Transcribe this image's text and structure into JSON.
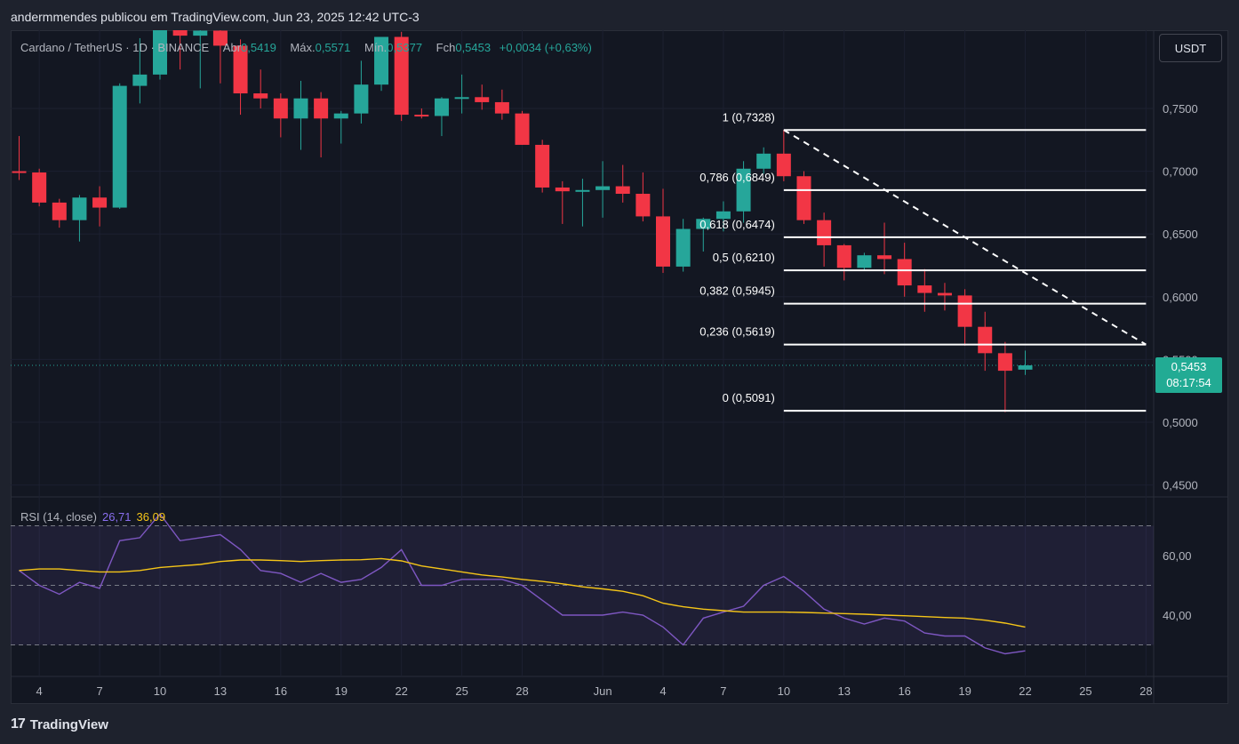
{
  "header": {
    "published_by": "andermmendes publicou em TradingView.com, Jun 23, 2025 12:42 UTC-3"
  },
  "legend": {
    "symbol": "Cardano / TetherUS · 1D · BINANCE",
    "open_label": "Abr",
    "open": "0,5419",
    "high_label": "Máx.",
    "high": "0,5571",
    "low_label": "Mín.",
    "low": "0,5377",
    "close_label": "Fch",
    "close": "0,5453",
    "change": "+0,0034 (+0,63%)"
  },
  "currency_button": "USDT",
  "price_tag": {
    "price": "0,5453",
    "countdown": "08:17:54"
  },
  "rsi_legend": {
    "name": "RSI (14, close)",
    "rsi": "26,71",
    "ma": "36,09"
  },
  "footer": {
    "brand": "TradingView",
    "logo_glyph": "17"
  },
  "colors": {
    "up": "#26a69a",
    "down": "#f23645",
    "rsi": "#7e57c2",
    "rsi_ma": "#f5c518",
    "background": "#131722"
  },
  "chart_data": [
    {
      "type": "candlestick",
      "title": "",
      "price_range": [
        0.445,
        0.79
      ],
      "y_ticks": [
        "0,7500",
        "0,7000",
        "0,6500",
        "0,6000",
        "0,5500",
        "0,5000",
        "0,4500"
      ],
      "y_tick_values": [
        0.75,
        0.7,
        0.65,
        0.6,
        0.55,
        0.5,
        0.45
      ],
      "x_ticks": [
        "4",
        "7",
        "10",
        "13",
        "16",
        "19",
        "22",
        "25",
        "28",
        "Jun",
        "4",
        "7",
        "10",
        "13",
        "16",
        "19",
        "22",
        "25",
        "28"
      ],
      "x_tick_days": [
        4,
        7,
        10,
        13,
        16,
        19,
        22,
        25,
        28,
        32,
        35,
        38,
        41,
        44,
        47,
        50,
        53,
        56,
        59
      ],
      "candles": [
        {
          "d": 3,
          "o": 0.7,
          "h": 0.728,
          "l": 0.693,
          "c": 0.699
        },
        {
          "d": 4,
          "o": 0.699,
          "h": 0.702,
          "l": 0.672,
          "c": 0.675
        },
        {
          "d": 5,
          "o": 0.675,
          "h": 0.678,
          "l": 0.655,
          "c": 0.661
        },
        {
          "d": 6,
          "o": 0.661,
          "h": 0.681,
          "l": 0.644,
          "c": 0.679
        },
        {
          "d": 7,
          "o": 0.679,
          "h": 0.688,
          "l": 0.656,
          "c": 0.671
        },
        {
          "d": 8,
          "o": 0.671,
          "h": 0.77,
          "l": 0.67,
          "c": 0.768
        },
        {
          "d": 9,
          "o": 0.768,
          "h": 0.806,
          "l": 0.754,
          "c": 0.777
        },
        {
          "d": 10,
          "o": 0.777,
          "h": 0.835,
          "l": 0.773,
          "c": 0.82
        },
        {
          "d": 11,
          "o": 0.82,
          "h": 0.838,
          "l": 0.781,
          "c": 0.808
        },
        {
          "d": 12,
          "o": 0.808,
          "h": 0.83,
          "l": 0.766,
          "c": 0.812
        },
        {
          "d": 13,
          "o": 0.812,
          "h": 0.832,
          "l": 0.77,
          "c": 0.8
        },
        {
          "d": 14,
          "o": 0.8,
          "h": 0.805,
          "l": 0.745,
          "c": 0.762
        },
        {
          "d": 15,
          "o": 0.762,
          "h": 0.781,
          "l": 0.75,
          "c": 0.758
        },
        {
          "d": 16,
          "o": 0.758,
          "h": 0.762,
          "l": 0.727,
          "c": 0.742
        },
        {
          "d": 17,
          "o": 0.742,
          "h": 0.772,
          "l": 0.717,
          "c": 0.758
        },
        {
          "d": 18,
          "o": 0.758,
          "h": 0.763,
          "l": 0.711,
          "c": 0.742
        },
        {
          "d": 19,
          "o": 0.742,
          "h": 0.748,
          "l": 0.722,
          "c": 0.746
        },
        {
          "d": 20,
          "o": 0.746,
          "h": 0.788,
          "l": 0.738,
          "c": 0.769
        },
        {
          "d": 21,
          "o": 0.769,
          "h": 0.802,
          "l": 0.764,
          "c": 0.807
        },
        {
          "d": 22,
          "o": 0.807,
          "h": 0.811,
          "l": 0.74,
          "c": 0.745
        },
        {
          "d": 23,
          "o": 0.745,
          "h": 0.75,
          "l": 0.742,
          "c": 0.744
        },
        {
          "d": 24,
          "o": 0.744,
          "h": 0.759,
          "l": 0.728,
          "c": 0.758
        },
        {
          "d": 25,
          "o": 0.758,
          "h": 0.777,
          "l": 0.746,
          "c": 0.759
        },
        {
          "d": 26,
          "o": 0.759,
          "h": 0.769,
          "l": 0.749,
          "c": 0.755
        },
        {
          "d": 27,
          "o": 0.755,
          "h": 0.765,
          "l": 0.741,
          "c": 0.746
        },
        {
          "d": 28,
          "o": 0.746,
          "h": 0.748,
          "l": 0.721,
          "c": 0.721
        },
        {
          "d": 29,
          "o": 0.721,
          "h": 0.725,
          "l": 0.683,
          "c": 0.687
        },
        {
          "d": 30,
          "o": 0.687,
          "h": 0.692,
          "l": 0.658,
          "c": 0.684
        },
        {
          "d": 31,
          "o": 0.684,
          "h": 0.694,
          "l": 0.656,
          "c": 0.685
        },
        {
          "d": 32,
          "o": 0.685,
          "h": 0.708,
          "l": 0.663,
          "c": 0.688
        },
        {
          "d": 33,
          "o": 0.688,
          "h": 0.705,
          "l": 0.675,
          "c": 0.682
        },
        {
          "d": 34,
          "o": 0.682,
          "h": 0.699,
          "l": 0.66,
          "c": 0.664
        },
        {
          "d": 35,
          "o": 0.664,
          "h": 0.686,
          "l": 0.619,
          "c": 0.624
        },
        {
          "d": 36,
          "o": 0.624,
          "h": 0.662,
          "l": 0.62,
          "c": 0.654
        },
        {
          "d": 37,
          "o": 0.654,
          "h": 0.663,
          "l": 0.636,
          "c": 0.662
        },
        {
          "d": 38,
          "o": 0.662,
          "h": 0.676,
          "l": 0.652,
          "c": 0.668
        },
        {
          "d": 39,
          "o": 0.668,
          "h": 0.708,
          "l": 0.659,
          "c": 0.702
        },
        {
          "d": 40,
          "o": 0.702,
          "h": 0.719,
          "l": 0.698,
          "c": 0.714
        },
        {
          "d": 41,
          "o": 0.714,
          "h": 0.733,
          "l": 0.692,
          "c": 0.696
        },
        {
          "d": 42,
          "o": 0.696,
          "h": 0.7,
          "l": 0.658,
          "c": 0.661
        },
        {
          "d": 43,
          "o": 0.661,
          "h": 0.667,
          "l": 0.624,
          "c": 0.641
        },
        {
          "d": 44,
          "o": 0.641,
          "h": 0.642,
          "l": 0.613,
          "c": 0.623
        },
        {
          "d": 45,
          "o": 0.623,
          "h": 0.635,
          "l": 0.621,
          "c": 0.633
        },
        {
          "d": 46,
          "o": 0.633,
          "h": 0.659,
          "l": 0.618,
          "c": 0.63
        },
        {
          "d": 47,
          "o": 0.63,
          "h": 0.643,
          "l": 0.6,
          "c": 0.609
        },
        {
          "d": 48,
          "o": 0.609,
          "h": 0.622,
          "l": 0.588,
          "c": 0.603
        },
        {
          "d": 49,
          "o": 0.603,
          "h": 0.611,
          "l": 0.589,
          "c": 0.601
        },
        {
          "d": 50,
          "o": 0.601,
          "h": 0.606,
          "l": 0.561,
          "c": 0.576
        },
        {
          "d": 51,
          "o": 0.576,
          "h": 0.588,
          "l": 0.541,
          "c": 0.555
        },
        {
          "d": 52,
          "o": 0.555,
          "h": 0.564,
          "l": 0.508,
          "c": 0.541
        },
        {
          "d": 53,
          "o": 0.5419,
          "h": 0.5571,
          "l": 0.5377,
          "c": 0.5453
        }
      ],
      "current_price": 0.5453,
      "fibonacci": {
        "start_day": 41,
        "end_day": 59,
        "levels": [
          {
            "ratio": "1",
            "price": 0.7328,
            "label": "1 (0,7328)"
          },
          {
            "ratio": "0.786",
            "price": 0.6849,
            "label": "0,786 (0,6849)"
          },
          {
            "ratio": "0.618",
            "price": 0.6474,
            "label": "0,618 (0,6474)"
          },
          {
            "ratio": "0.5",
            "price": 0.621,
            "label": "0,5 (0,6210)"
          },
          {
            "ratio": "0.382",
            "price": 0.5945,
            "label": "0,382 (0,5945)"
          },
          {
            "ratio": "0.236",
            "price": 0.5619,
            "label": "0,236 (0,5619)"
          },
          {
            "ratio": "0",
            "price": 0.5091,
            "label": "0 (0,5091)"
          }
        ],
        "diagonal": {
          "from_day": 41,
          "from_price": 0.7328,
          "to_day": 59,
          "to_price": 0.5619
        }
      }
    },
    {
      "type": "line",
      "title": "RSI (14, close)",
      "y_range": [
        22,
        75
      ],
      "y_ticks": [
        "60,00",
        "40,00"
      ],
      "y_tick_values": [
        60,
        40
      ],
      "bands": [
        70,
        50,
        30
      ],
      "series": [
        {
          "name": "RSI",
          "color": "#7e57c2",
          "days": [
            3,
            4,
            5,
            6,
            7,
            8,
            9,
            10,
            11,
            12,
            13,
            14,
            15,
            16,
            17,
            18,
            19,
            20,
            21,
            22,
            23,
            24,
            25,
            26,
            27,
            28,
            29,
            30,
            31,
            32,
            33,
            34,
            35,
            36,
            37,
            38,
            39,
            40,
            41,
            42,
            43,
            44,
            45,
            46,
            47,
            48,
            49,
            50,
            51,
            52,
            53
          ],
          "values": [
            55,
            50,
            47,
            51,
            49,
            65,
            66,
            74,
            65,
            66,
            67,
            62,
            55,
            54,
            51,
            54,
            51,
            52,
            56,
            62,
            50,
            50,
            52,
            52,
            52,
            50,
            45,
            40,
            40,
            40,
            41,
            40,
            36,
            30,
            39,
            41,
            43,
            50,
            53,
            48,
            42,
            39,
            37,
            39,
            38,
            34,
            33,
            33,
            29,
            27,
            28
          ]
        },
        {
          "name": "RSI-based MA",
          "color": "#f5c518",
          "days": [
            3,
            4,
            5,
            6,
            7,
            8,
            9,
            10,
            11,
            12,
            13,
            14,
            15,
            16,
            17,
            18,
            19,
            20,
            21,
            22,
            23,
            24,
            25,
            26,
            27,
            28,
            29,
            30,
            31,
            32,
            33,
            34,
            35,
            36,
            37,
            38,
            39,
            40,
            41,
            42,
            43,
            44,
            45,
            46,
            47,
            48,
            49,
            50,
            51,
            52,
            53
          ],
          "values": [
            55,
            55.5,
            55.5,
            55,
            54.5,
            54.5,
            55,
            56,
            56.5,
            57,
            58,
            58.5,
            58.5,
            58.3,
            58,
            58.3,
            58.5,
            58.6,
            59,
            58.2,
            56.5,
            55.5,
            54.5,
            53.5,
            52.8,
            52,
            51.3,
            50.5,
            49.5,
            48.8,
            48,
            46.5,
            44,
            42.8,
            42,
            41.5,
            41,
            41,
            41,
            40.9,
            40.7,
            40.5,
            40.3,
            40,
            39.8,
            39.5,
            39.2,
            39,
            38.3,
            37.3,
            36
          ]
        }
      ]
    }
  ]
}
